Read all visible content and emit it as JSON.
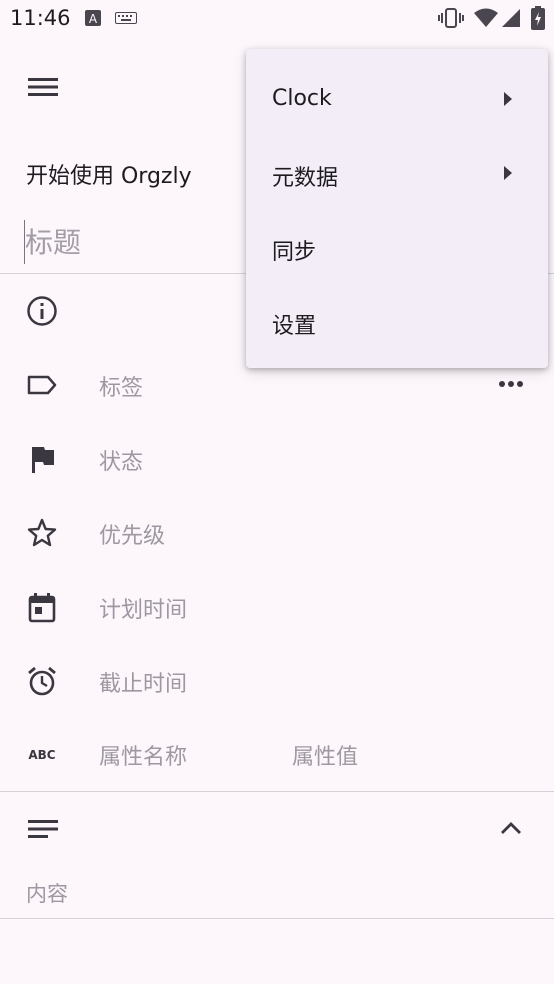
{
  "status_bar": {
    "time": "11:46"
  },
  "toolbar": {
    "menu_icon": "hamburger-icon",
    "more_icon": "more-horiz-icon"
  },
  "note": {
    "book_title": "开始使用 Orgzly",
    "title_placeholder": "标题"
  },
  "fields": {
    "tags": "标签",
    "state": "状态",
    "priority": "优先级",
    "scheduled": "计划时间",
    "deadline": "截止时间",
    "property_name": "属性名称",
    "property_value": "属性值"
  },
  "content": {
    "placeholder": "内容"
  },
  "menu": {
    "items": [
      {
        "label": "Clock",
        "has_submenu": true
      },
      {
        "label": "元数据",
        "has_submenu": true
      },
      {
        "label": "同步",
        "has_submenu": false
      },
      {
        "label": "设置",
        "has_submenu": false
      }
    ]
  },
  "colors": {
    "background": "#FDF7FC",
    "menu_background": "#F2EDF6",
    "hint_text": "#9D98A1"
  }
}
